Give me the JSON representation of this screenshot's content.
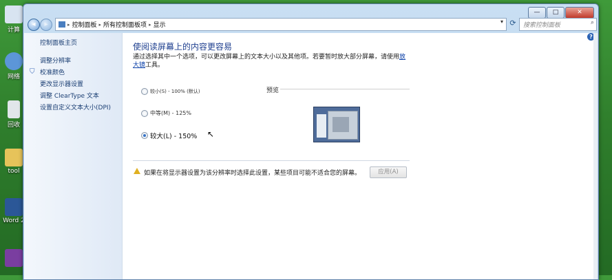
{
  "desktop": {
    "icons": [
      {
        "label": "计算",
        "color": "#d8e4f1"
      },
      {
        "label": "网络",
        "color": "#5c96d8"
      },
      {
        "label": "回收",
        "color": "#e1e6ea"
      },
      {
        "label": "tool",
        "color": "#e6c35a"
      },
      {
        "label": "Word 2",
        "color": "#2b5797"
      },
      {
        "label": "",
        "color": "#7a3ea0"
      }
    ]
  },
  "window": {
    "caption": {
      "minimize": "—",
      "maximize": "□",
      "close": "✕"
    },
    "address": {
      "segments": [
        "控制面板",
        "所有控制面板项",
        "显示"
      ],
      "separator": "▸"
    },
    "search": {
      "placeholder": "搜索控制面板"
    }
  },
  "sidebar": {
    "title": "控制面板主页",
    "links": [
      "调整分辨率",
      "校准颜色",
      "更改显示器设置",
      "调整 ClearType 文本",
      "设置自定义文本大小(DPI)"
    ]
  },
  "main": {
    "heading": "使阅读屏幕上的内容更容易",
    "desc_before": "通过选择其中一个选项，可以更改屏幕上的文本大小以及其他项。若要暂时放大部分屏幕，请使用",
    "desc_link": "放大镜",
    "desc_after": "工具。",
    "options": [
      {
        "label": "较小(S) - 100% (默认)",
        "checked": false
      },
      {
        "label": "中等(M) - 125%",
        "checked": false
      },
      {
        "label": "较大(L) - 150%",
        "checked": true
      }
    ],
    "preview_label": "预览",
    "warning": "如果在将显示器设置为该分辨率时选择此设置，某些项目可能不适合您的屏幕。",
    "apply_label": "应用(A)"
  },
  "colors": {
    "accent": "#1e3f8f",
    "link": "#0b40a8"
  }
}
